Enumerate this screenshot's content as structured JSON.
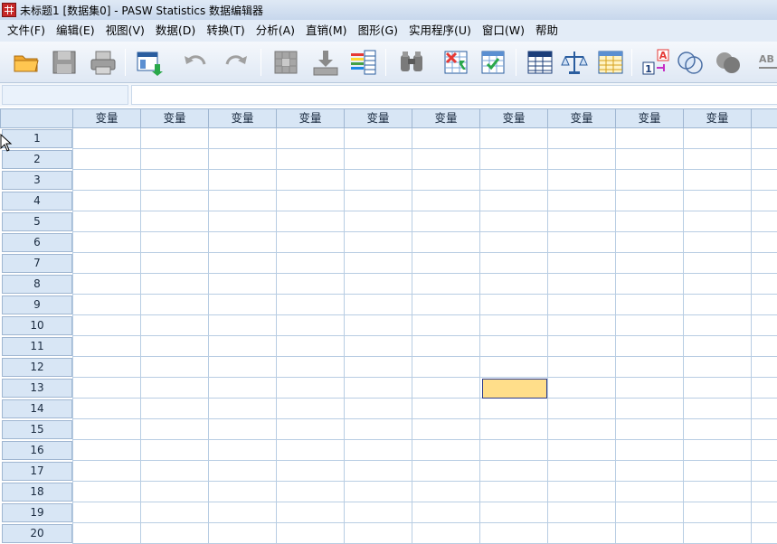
{
  "window": {
    "title": "未标题1 [数据集0] - PASW Statistics 数据编辑器"
  },
  "menu": [
    {
      "label": "文件(F)"
    },
    {
      "label": "编辑(E)"
    },
    {
      "label": "视图(V)"
    },
    {
      "label": "数据(D)"
    },
    {
      "label": "转换(T)"
    },
    {
      "label": "分析(A)"
    },
    {
      "label": "直销(M)"
    },
    {
      "label": "图形(G)"
    },
    {
      "label": "实用程序(U)"
    },
    {
      "label": "窗口(W)"
    },
    {
      "label": "帮助"
    }
  ],
  "toolbar": {
    "icons": [
      "open-file-icon",
      "save-icon",
      "print-icon",
      "recall-dialog-icon",
      "undo-icon",
      "redo-icon",
      "goto-case-icon",
      "goto-variable-icon",
      "variables-icon",
      "find-icon",
      "insert-cases-icon",
      "insert-variable-icon",
      "split-file-icon",
      "weight-cases-icon",
      "select-cases-icon",
      "value-labels-icon",
      "use-sets-icon",
      "show-all-variables-icon",
      "spell-check-icon"
    ]
  },
  "grid": {
    "column_header": "变量",
    "columns": [
      "变量",
      "变量",
      "变量",
      "变量",
      "变量",
      "变量",
      "变量",
      "变量",
      "变量",
      "变量",
      "变"
    ],
    "rows": [
      "1",
      "2",
      "3",
      "4",
      "5",
      "6",
      "7",
      "8",
      "9",
      "10",
      "11",
      "12",
      "13",
      "14",
      "15",
      "16",
      "17",
      "18",
      "19",
      "20"
    ],
    "active_cell": {
      "row": "13",
      "column_index": 6
    }
  },
  "colors": {
    "active_cell": "#ffde8a",
    "header_bg": "#d8e6f5",
    "grid_line": "#b8cde3"
  }
}
